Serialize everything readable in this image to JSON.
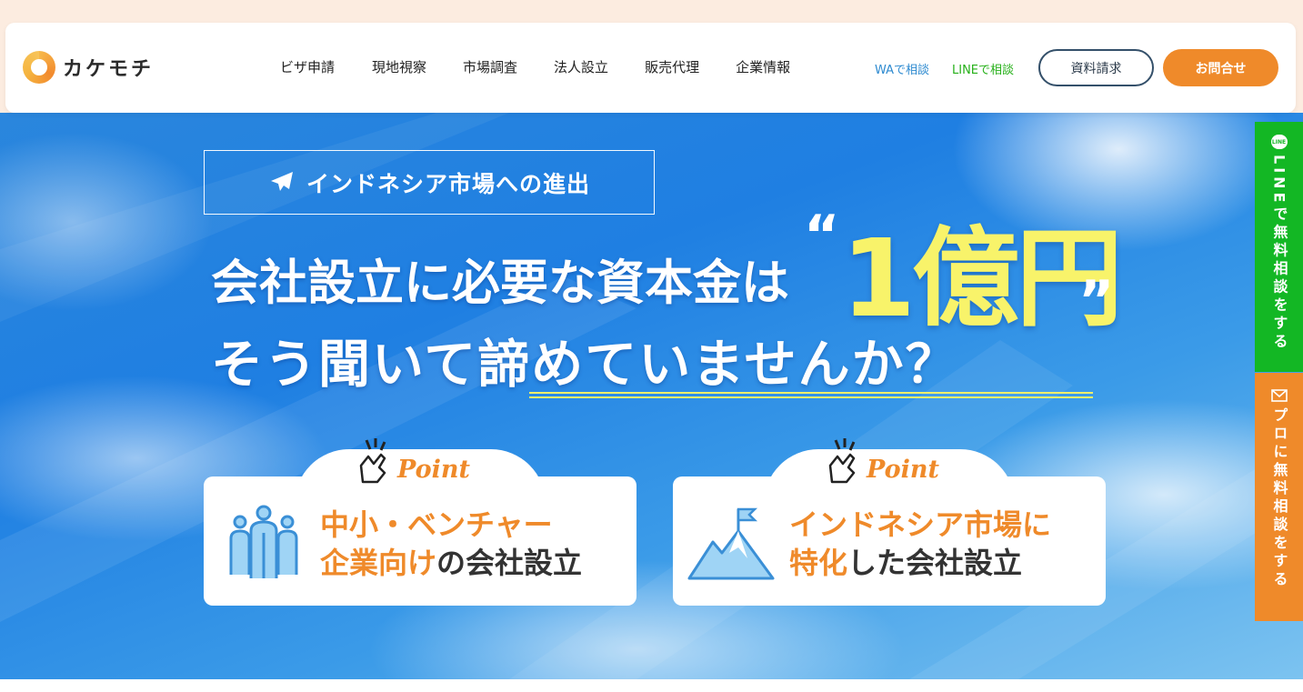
{
  "header": {
    "logo_text": "カケモチ",
    "nav": [
      "ビザ申請",
      "現地視察",
      "市場調査",
      "法人設立",
      "販売代理",
      "企業情報"
    ],
    "wa_link": "WAで相談",
    "line_link": "LINEで相談",
    "docs_button": "資料請求",
    "contact_button": "お問合せ"
  },
  "hero": {
    "tag": "インドネシア市場への進出",
    "headline1": "会社設立に必要な資本金は",
    "amount": "1億円",
    "quote_open": "“",
    "quote_close": "”",
    "headline2": "そう聞いて諦めていませんか？",
    "points": [
      {
        "badge": "Point",
        "line1_orange": "中小・ベンチャー",
        "line2_orange": "企業向け",
        "line2_dark": "の会社設立",
        "icon": "people-icon"
      },
      {
        "badge": "Point",
        "line1_orange": "インドネシア市場に",
        "line2_orange": "特化",
        "line2_dark": "した会社設立",
        "icon": "mountain-flag-icon"
      }
    ]
  },
  "side_tabs": {
    "line_icon_text": "LINE",
    "line": "LINEで無料相談をする",
    "pro": "プロに無料相談をする"
  },
  "colors": {
    "accent_orange": "#ef8a2a",
    "line_green": "#13b724",
    "highlight_yellow": "#f8f36a",
    "wa_blue": "#2d8ad0"
  }
}
